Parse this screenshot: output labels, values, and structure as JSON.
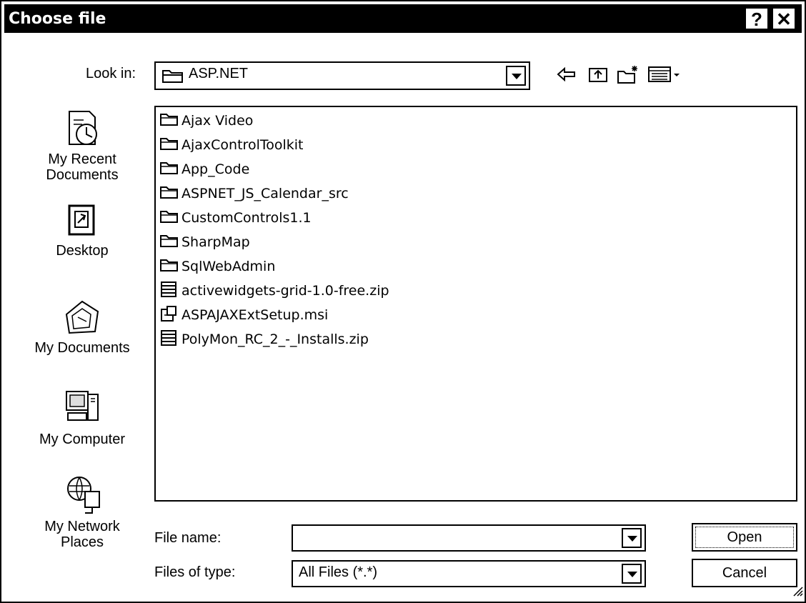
{
  "window": {
    "title": "Choose file",
    "help_glyph": "?",
    "close_glyph": "✕"
  },
  "lookin": {
    "label": "Look in:",
    "value": "ASP.NET",
    "toolbar_icons": [
      "back-arrow-icon",
      "up-folder-icon",
      "new-folder-icon",
      "view-menu-icon"
    ]
  },
  "places": [
    {
      "label_1": "My Recent",
      "label_2": "Documents",
      "icon": "recent-documents-icon"
    },
    {
      "label_1": "Desktop",
      "label_2": "",
      "icon": "desktop-icon"
    },
    {
      "label_1": "My Documents",
      "label_2": "",
      "icon": "my-documents-icon"
    },
    {
      "label_1": "My Computer",
      "label_2": "",
      "icon": "my-computer-icon"
    },
    {
      "label_1": "My Network",
      "label_2": "Places",
      "icon": "network-places-icon"
    }
  ],
  "files": [
    {
      "name": "Ajax Video",
      "type": "folder"
    },
    {
      "name": "AjaxControlToolkit",
      "type": "folder"
    },
    {
      "name": "App_Code",
      "type": "folder"
    },
    {
      "name": "ASPNET_JS_Calendar_src",
      "type": "folder"
    },
    {
      "name": "CustomControls1.1",
      "type": "folder"
    },
    {
      "name": "SharpMap",
      "type": "folder"
    },
    {
      "name": "SqlWebAdmin",
      "type": "folder"
    },
    {
      "name": "activewidgets-grid-1.0-free.zip",
      "type": "zip"
    },
    {
      "name": "ASPAJAXExtSetup.msi",
      "type": "msi"
    },
    {
      "name": "PolyMon_RC_2_-_Installs.zip",
      "type": "zip"
    }
  ],
  "filename": {
    "label": "File name:",
    "value": ""
  },
  "filetype": {
    "label": "Files of type:",
    "value": "All Files (*.*)"
  },
  "buttons": {
    "open": "Open",
    "cancel": "Cancel"
  }
}
